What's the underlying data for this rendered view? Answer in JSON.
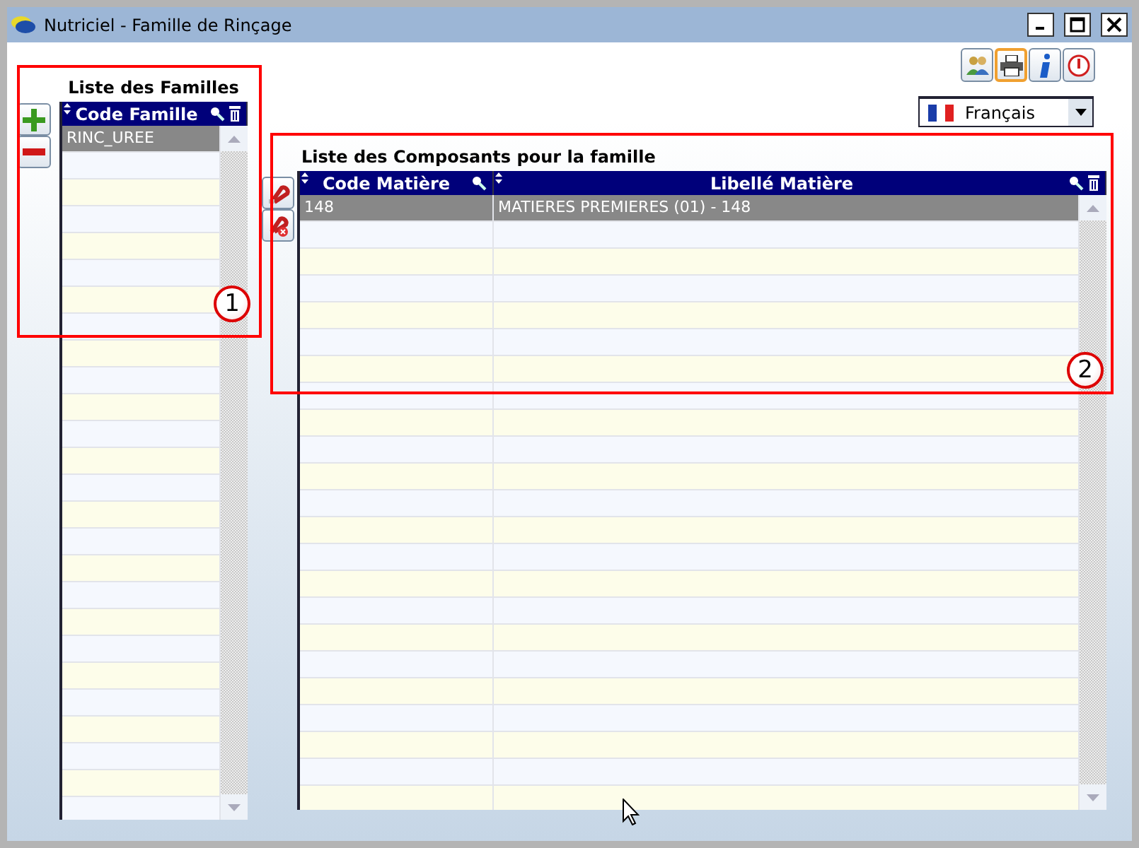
{
  "window": {
    "title": "Nutriciel - Famille de Rinçage"
  },
  "families": {
    "title": "Liste des Familles",
    "columns": [
      "Code Famille"
    ],
    "rows": [
      {
        "cells": [
          "RINC_UREE"
        ],
        "selected": true
      }
    ]
  },
  "language": {
    "value": "Français"
  },
  "components": {
    "title": "Liste des Composants pour la famille",
    "columns": [
      "Code Matière",
      "Libellé Matière"
    ],
    "rows": [
      {
        "cells": [
          "148",
          "MATIERES PREMIERES (01) - 148"
        ],
        "selected": true
      }
    ]
  },
  "annotations": [
    {
      "label": "1"
    },
    {
      "label": "2"
    }
  ]
}
